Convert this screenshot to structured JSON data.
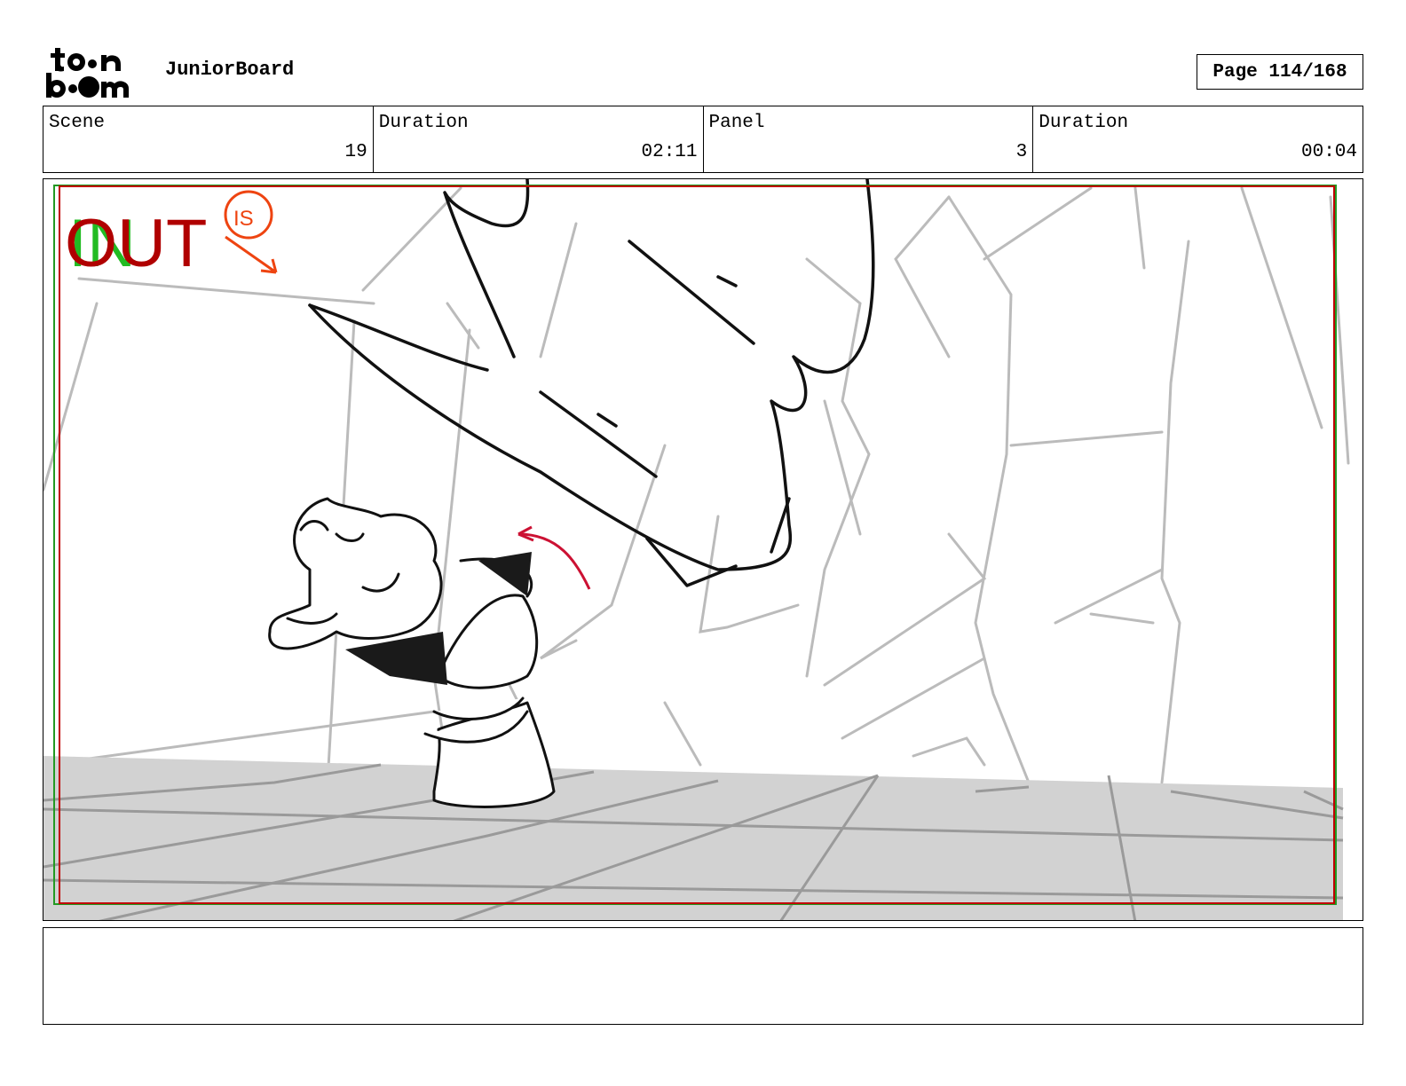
{
  "header": {
    "logo_text": "toon boom",
    "app_name": "JuniorBoard",
    "page_label": "Page 114/168"
  },
  "info": {
    "scene_label": "Scene",
    "scene_value": "19",
    "scene_duration_label": "Duration",
    "scene_duration_value": "02:11",
    "panel_label": "Panel",
    "panel_value": "3",
    "panel_duration_label": "Duration",
    "panel_duration_value": "00:04"
  },
  "panel_image": {
    "out_label": "OUT",
    "in_label": "IN",
    "circle_note": "IS",
    "colors": {
      "out_text": "#b00000",
      "in_text": "#22bb22",
      "annotation": "#ee4411",
      "safe_frame_red": "#c00000",
      "safe_frame_green": "#229922",
      "floor_gray": "#cfcfcf",
      "bg_lines": "#b8b8b8",
      "arrow": "#cc1133"
    }
  },
  "notes": {
    "text": ""
  }
}
